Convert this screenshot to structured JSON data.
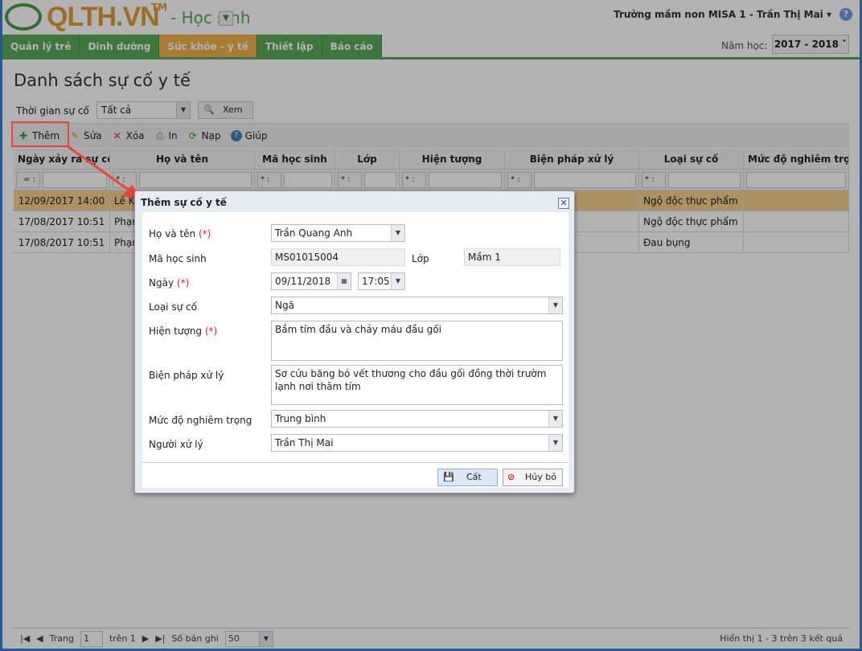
{
  "app": {
    "logo": "QLTH.VN",
    "tm": "TM",
    "module": "- Học sinh",
    "user": "Trường mầm non MISA 1 - Trần Thị Mai ▾",
    "year_label": "Năm học:",
    "year": "2017 - 2018"
  },
  "nav": [
    "Quản lý trẻ",
    "Dinh dưỡng",
    "Sức khỏe - y tế",
    "Thiết lập",
    "Báo cáo"
  ],
  "page": {
    "title": "Danh sách sự cố y tế",
    "filter_label": "Thời gian sự cố",
    "filter_value": "Tất cả",
    "view_button": "Xem"
  },
  "toolbar": {
    "add": "Thêm",
    "edit": "Sửa",
    "delete": "Xóa",
    "print": "In",
    "reload": "Nạp",
    "help": "Giúp"
  },
  "grid": {
    "columns": [
      "Ngày xảy ra sự cố",
      "Họ và tên",
      "Mã học sinh",
      "Lớp",
      "Hiện tượng",
      "Biện pháp xử lý",
      "Loại sự cố",
      "Mức độ nghiêm trọng"
    ],
    "filter_ops": [
      "= :",
      "* :",
      "* :",
      "* :",
      "* :",
      "* :",
      "* :"
    ],
    "rows": [
      {
        "date": "12/09/2017 14:00",
        "name": "Lê Ki",
        "type": "Ngộ độc thực phẩm"
      },
      {
        "date": "17/08/2017 10:51",
        "name": "Phạm",
        "type": "Ngộ độc thực phẩm"
      },
      {
        "date": "17/08/2017 10:51",
        "name": "Phạm",
        "type": "Đau bụng"
      }
    ]
  },
  "footer": {
    "page_label": "Trang",
    "page": "1",
    "of": "trên 1",
    "records_label": "Số bản ghi",
    "records": "50",
    "summary": "Hiển thị 1 - 3 trên 3 kết quả"
  },
  "dialog": {
    "title": "Thêm sự cố y tế",
    "req": "(*)",
    "name_label": "Họ và tên",
    "name": "Trần Quang Anh",
    "code_label": "Mã học sinh",
    "code": "MS01015004",
    "class_label": "Lớp",
    "class": "Mầm 1",
    "date_label": "Ngày",
    "date": "09/11/2018",
    "time": "17:05",
    "type_label": "Loại sự cố",
    "type": "Ngã",
    "symptom_label": "Hiện tượng",
    "symptom": "Bầm tím đầu và chảy máu đầu gối",
    "action_label": "Biện pháp xử lý",
    "action": "Sơ cứu băng bó vết thương cho đầu gối đồng thời trườm lạnh nơi thâm tím",
    "severity_label": "Mức độ nghiêm trọng",
    "severity": "Trung bình",
    "handler_label": "Người xử lý",
    "handler": "Trần  Thị Mai",
    "save": "Cất",
    "cancel": "Hủy bỏ"
  },
  "colors": {
    "green": "#5aa95a",
    "orange": "#f3b24b",
    "annotation": "#e8473b"
  }
}
